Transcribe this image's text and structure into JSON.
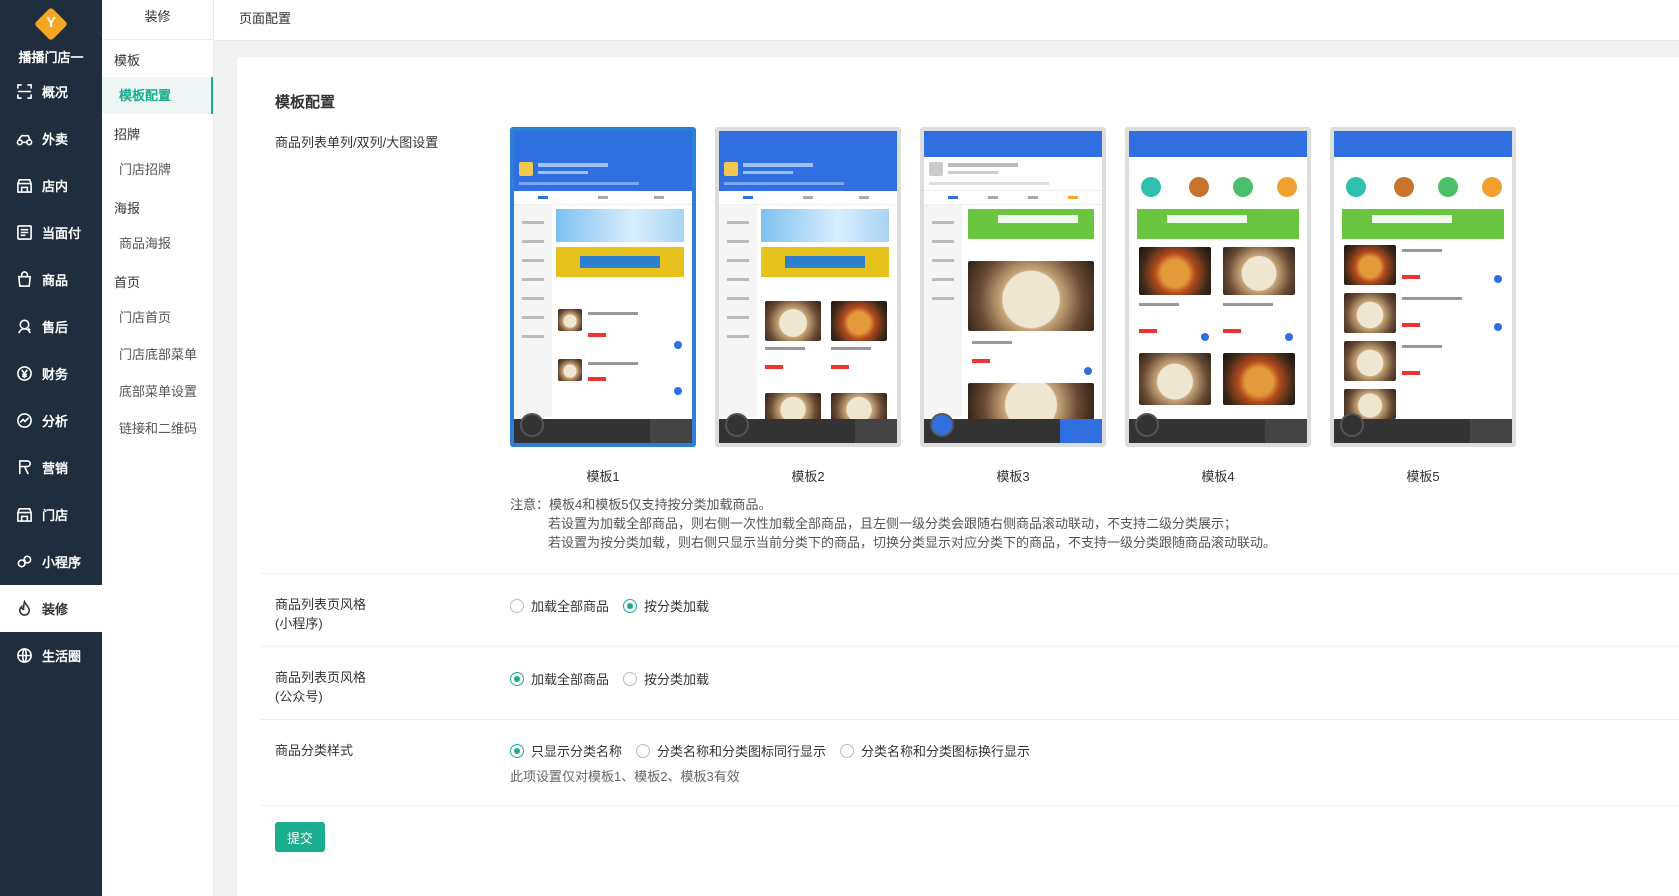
{
  "app": {
    "store_name": "播播门店一",
    "logo_letter": "Y"
  },
  "nav": {
    "items": [
      {
        "label": "概况",
        "icon": "overview-icon"
      },
      {
        "label": "外卖",
        "icon": "delivery-icon"
      },
      {
        "label": "店内",
        "icon": "store-icon"
      },
      {
        "label": "当面付",
        "icon": "pay-icon"
      },
      {
        "label": "商品",
        "icon": "goods-icon"
      },
      {
        "label": "售后",
        "icon": "aftersale-icon"
      },
      {
        "label": "财务",
        "icon": "finance-icon"
      },
      {
        "label": "分析",
        "icon": "analysis-icon"
      },
      {
        "label": "营销",
        "icon": "marketing-icon"
      },
      {
        "label": "门店",
        "icon": "shop-icon"
      },
      {
        "label": "小程序",
        "icon": "miniprogram-icon"
      },
      {
        "label": "装修",
        "icon": "decorate-icon",
        "active": true
      },
      {
        "label": "生活圈",
        "icon": "globe-icon"
      }
    ]
  },
  "subnav": {
    "title": "装修",
    "groups": [
      {
        "label": "模板",
        "items": [
          {
            "label": "模板配置",
            "active": true
          }
        ]
      },
      {
        "label": "招牌",
        "items": [
          {
            "label": "门店招牌"
          }
        ]
      },
      {
        "label": "海报",
        "items": [
          {
            "label": "商品海报"
          }
        ]
      },
      {
        "label": "首页",
        "items": [
          {
            "label": "门店首页"
          },
          {
            "label": "门店底部菜单"
          },
          {
            "label": "底部菜单设置"
          },
          {
            "label": "链接和二维码"
          }
        ]
      }
    ]
  },
  "topbar": {
    "breadcrumb": "页面配置"
  },
  "main": {
    "title": "模板配置",
    "template_row_label": "商品列表单列/双列/大图设置",
    "templates": [
      {
        "name": "模板1",
        "selected": true
      },
      {
        "name": "模板2"
      },
      {
        "name": "模板3"
      },
      {
        "name": "模板4"
      },
      {
        "name": "模板5"
      }
    ],
    "note": {
      "line1": "注意：模板4和模板5仅支持按分类加载商品。",
      "line2": "若设置为加载全部商品，则右侧一次性加载全部商品，且左侧一级分类会跟随右侧商品滚动联动，不支持二级分类展示；",
      "line3": "若设置为按分类加载，则右侧只显示当前分类下的商品，切换分类显示对应分类下的商品，不支持一级分类跟随商品滚动联动。"
    },
    "style_mini": {
      "label1": "商品列表页风格",
      "label2": "(小程序)",
      "options": [
        {
          "label": "加载全部商品",
          "checked": false
        },
        {
          "label": "按分类加载",
          "checked": true
        }
      ]
    },
    "style_mp": {
      "label1": "商品列表页风格",
      "label2": "(公众号)",
      "options": [
        {
          "label": "加载全部商品",
          "checked": true
        },
        {
          "label": "按分类加载",
          "checked": false
        }
      ]
    },
    "category_style": {
      "label": "商品分类样式",
      "options": [
        {
          "label": "只显示分类名称",
          "checked": true
        },
        {
          "label": "分类名称和分类图标同行显示",
          "checked": false
        },
        {
          "label": "分类名称和分类图标换行显示",
          "checked": false
        }
      ],
      "hint": "此项设置仅对模板1、模板2、模板3有效"
    },
    "submit_label": "提交"
  },
  "colors": {
    "sidebar": "#1f2d3d",
    "accent": "#1aad8e",
    "template_selected": "#2b7fd6"
  }
}
